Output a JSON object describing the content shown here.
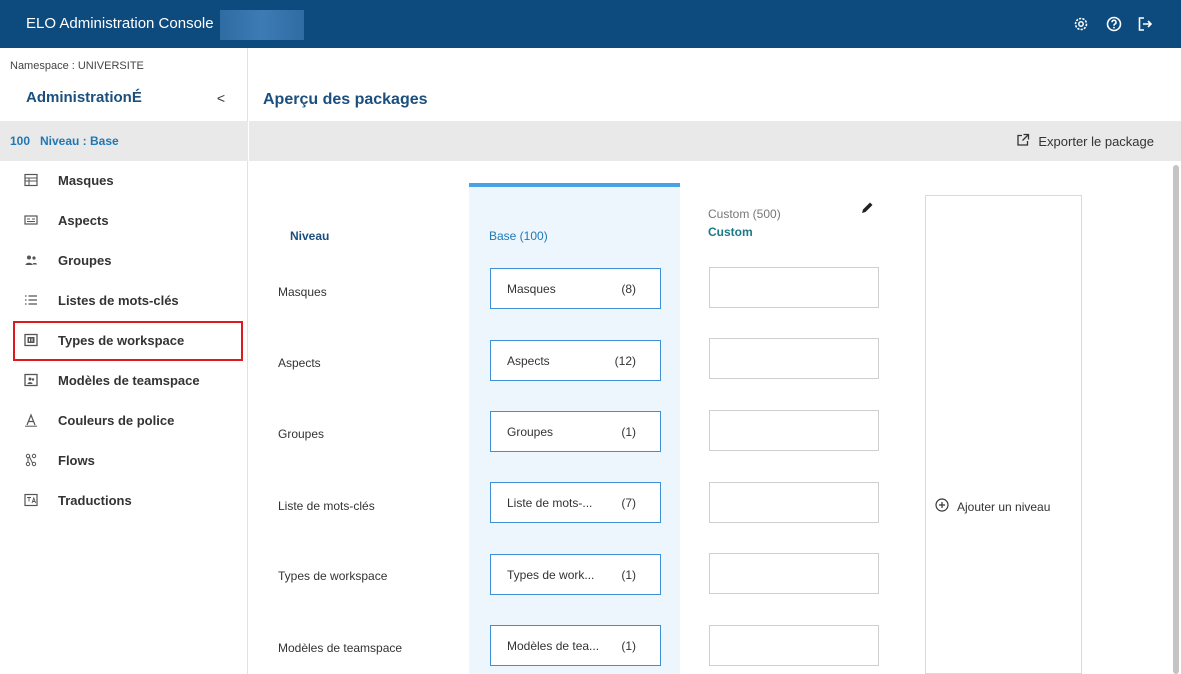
{
  "app": {
    "title": "ELO Administration Console"
  },
  "topbar_icons": [
    "gear-icon",
    "help-icon",
    "logout-icon"
  ],
  "sidebar": {
    "namespace": "Namespace : UNIVERSITE",
    "title": "AdministrationÉ",
    "collapse": "<",
    "level_number": "100",
    "level_label": "Niveau : Base",
    "items": [
      {
        "label": "Masques",
        "icon": "masks-icon"
      },
      {
        "label": "Aspects",
        "icon": "aspects-icon"
      },
      {
        "label": "Groupes",
        "icon": "groups-icon"
      },
      {
        "label": "Listes de mots-clés",
        "icon": "list-icon"
      },
      {
        "label": "Types de workspace",
        "icon": "workspace-types-icon"
      },
      {
        "label": "Modèles de teamspace",
        "icon": "teamspace-templates-icon"
      },
      {
        "label": "Couleurs de police",
        "icon": "font-color-icon"
      },
      {
        "label": "Flows",
        "icon": "flows-icon"
      },
      {
        "label": "Traductions",
        "icon": "translations-icon"
      }
    ]
  },
  "main": {
    "page_title": "Aperçu des packages",
    "export_label": "Exporter le package",
    "level_header": "Niveau",
    "base_header": "Base (100)",
    "custom_header_top": "Custom (500)",
    "custom_header_name": "Custom",
    "add_level": "Ajouter un niveau",
    "rows": [
      {
        "label": "Masques",
        "pkg_name": "Masques",
        "pkg_count": "(8)"
      },
      {
        "label": "Aspects",
        "pkg_name": "Aspects",
        "pkg_count": "(12)"
      },
      {
        "label": "Groupes",
        "pkg_name": "Groupes",
        "pkg_count": "(1)"
      },
      {
        "label": "Liste de mots-clés",
        "pkg_name": "Liste de mots-...",
        "pkg_count": "(7)"
      },
      {
        "label": "Types de workspace",
        "pkg_name": "Types de work...",
        "pkg_count": "(1)"
      },
      {
        "label": "Modèles de teamspace",
        "pkg_name": "Modèles de tea...",
        "pkg_count": "(1)"
      }
    ]
  },
  "colors": {
    "topbar": "#0d4a7e",
    "accent": "#1f78b4",
    "base_column": "#edf5fd",
    "highlight": "#e0191e"
  }
}
